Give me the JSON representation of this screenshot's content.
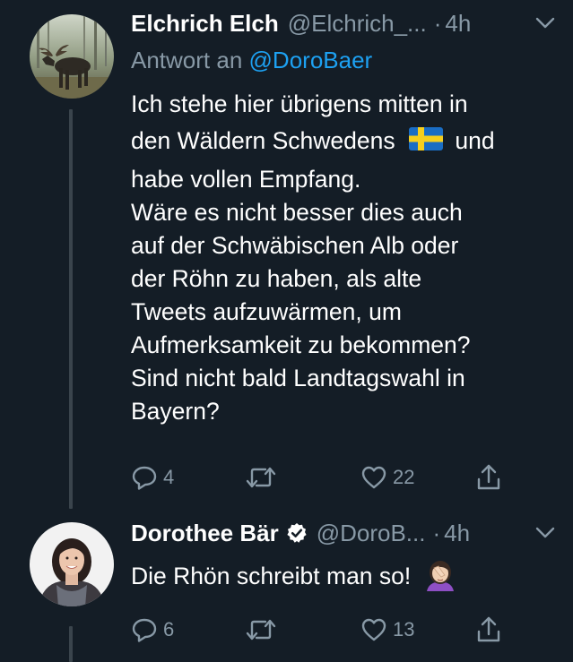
{
  "tweets": [
    {
      "name": "Elchrich Elch",
      "handle": "@Elchrich_...",
      "dot": "·",
      "time": "4h",
      "reply_prefix": "Antwort an",
      "reply_handle": "@DoroBaer",
      "text_lines": [
        "Ich stehe hier übrigens mitten in",
        "den Wäldern Schwedens",
        "und",
        "habe vollen Empfang.",
        "Wäre es nicht besser dies auch",
        "auf der Schwäbischen Alb oder",
        "der Röhn zu haben, als alte",
        "Tweets aufzuwärmen, um",
        "Aufmerksamkeit zu bekommen?",
        "Sind nicht bald Landtagswahl in",
        "Bayern?"
      ],
      "reply_count": "4",
      "retweet_count": "",
      "like_count": "22",
      "avatar_icon": "moose-avatar",
      "flag_icon": "sweden-flag-icon"
    },
    {
      "name": "Dorothee Bär",
      "handle": "@DoroB...",
      "dot": "·",
      "time": "4h",
      "text": "Die Rhön schreibt man so!",
      "reply_count": "6",
      "retweet_count": "",
      "like_count": "13",
      "avatar_icon": "woman-avatar",
      "emoji_icon": "facepalm-emoji-icon",
      "verified": true
    }
  ],
  "colors": {
    "background": "#141d26",
    "primary_text": "#ffffff",
    "secondary_text": "#8899a6",
    "link": "#1da1f2",
    "thread_line": "#3a444c"
  }
}
